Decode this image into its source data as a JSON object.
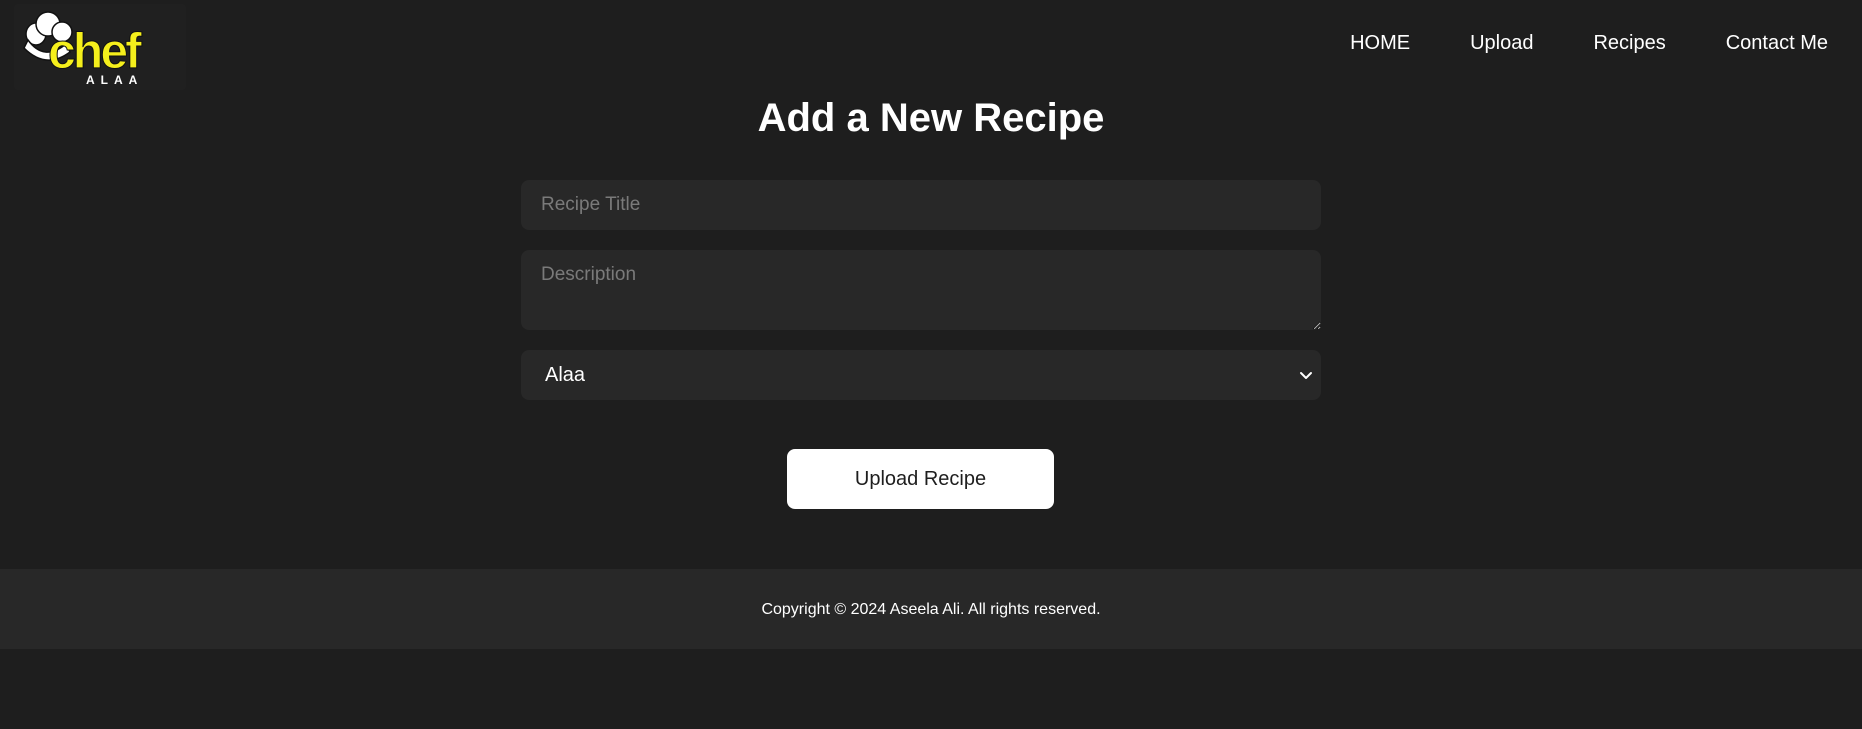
{
  "brand": {
    "logo_word": "chef",
    "logo_sub": "ALAA",
    "logo_color": "#f5ef1c"
  },
  "nav": {
    "items": [
      {
        "label": "HOME"
      },
      {
        "label": "Upload"
      },
      {
        "label": "Recipes"
      },
      {
        "label": "Contact Me"
      }
    ]
  },
  "page": {
    "title": "Add a New Recipe"
  },
  "form": {
    "title_placeholder": "Recipe Title",
    "description_placeholder": "Description",
    "author_select": {
      "selected": "Alaa"
    },
    "submit_label": "Upload Recipe"
  },
  "footer": {
    "copyright": "Copyright © 2024 Aseela Ali. All rights reserved."
  },
  "colors": {
    "background": "#1e1e1e",
    "surface": "#282828",
    "text": "#ffffff",
    "placeholder": "#7a7a7a",
    "accent": "#f5ef1c"
  }
}
